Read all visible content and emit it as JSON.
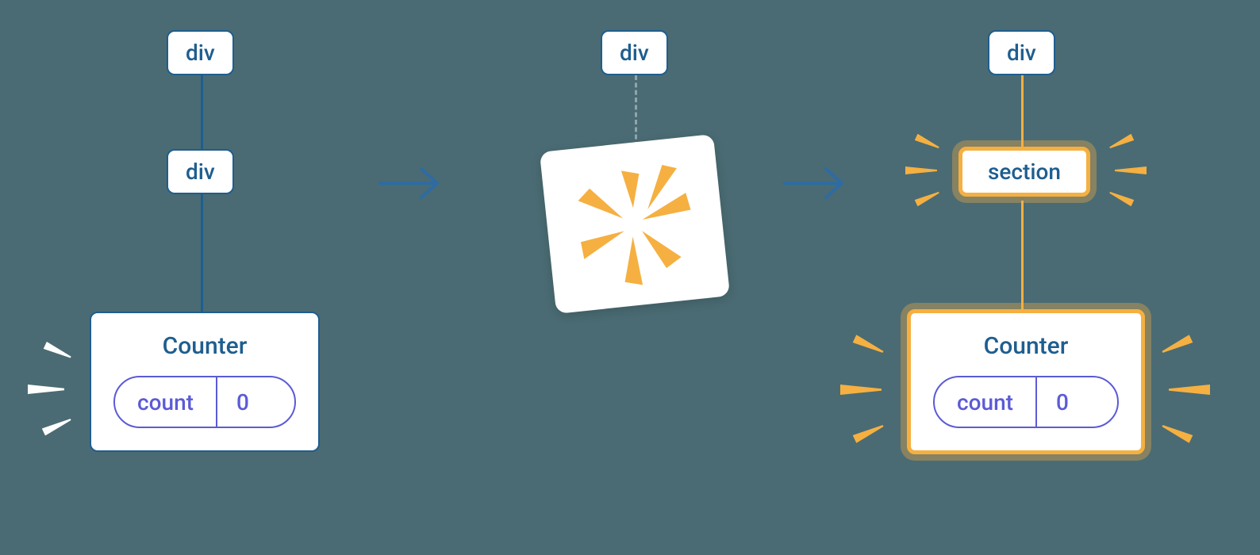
{
  "stage1": {
    "top": {
      "label": "div"
    },
    "mid": {
      "label": "div"
    },
    "counter": {
      "title": "Counter",
      "state_key": "count",
      "state_val": "0"
    }
  },
  "stage2": {
    "top": {
      "label": "div"
    }
  },
  "stage3": {
    "top": {
      "label": "div"
    },
    "mid": {
      "label": "section"
    },
    "counter": {
      "title": "Counter",
      "state_key": "count",
      "state_val": "0"
    }
  },
  "colors": {
    "bg": "#4a6b73",
    "node_border": "#1e5e8f",
    "node_text": "#1e5e8f",
    "pill": "#5b5bd6",
    "highlight": "#f5b041",
    "arrow": "#2e6ba3"
  }
}
